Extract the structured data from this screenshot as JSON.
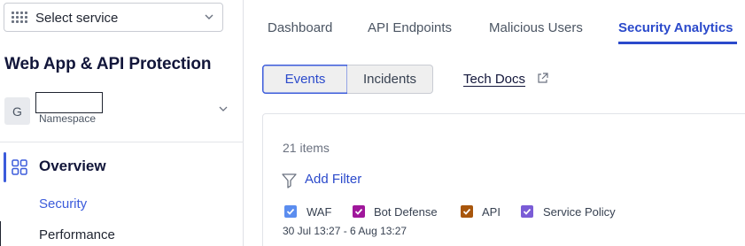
{
  "sidebar": {
    "service_select": {
      "label": "Select service"
    },
    "product_title": "Web App & API Protection",
    "namespace": {
      "avatar_letter": "G",
      "label": "Namespace"
    },
    "nav": {
      "overview": "Overview",
      "security": "Security",
      "performance": "Performance"
    }
  },
  "main": {
    "tabs": [
      {
        "label": "Dashboard",
        "active": false
      },
      {
        "label": "API Endpoints",
        "active": false
      },
      {
        "label": "Malicious Users",
        "active": false
      },
      {
        "label": "Security Analytics",
        "active": true
      }
    ],
    "segments": {
      "events": "Events",
      "incidents": "Incidents",
      "active": "Events"
    },
    "tech_docs": "Tech Docs",
    "panel": {
      "items_count": "21 items",
      "add_filter": "Add Filter",
      "legend": [
        {
          "label": "WAF",
          "color": "#5b8def",
          "checked": true
        },
        {
          "label": "Bot Defense",
          "color": "#a0179b",
          "checked": true
        },
        {
          "label": "API",
          "color": "#a8560c",
          "checked": true
        },
        {
          "label": "Service Policy",
          "color": "#7a5cd6",
          "checked": true
        }
      ],
      "date_range": "30 Jul 13:27 - 6 Aug 13:27"
    }
  },
  "colors": {
    "accent": "#2b4acb",
    "brand_dark": "#12163a"
  }
}
